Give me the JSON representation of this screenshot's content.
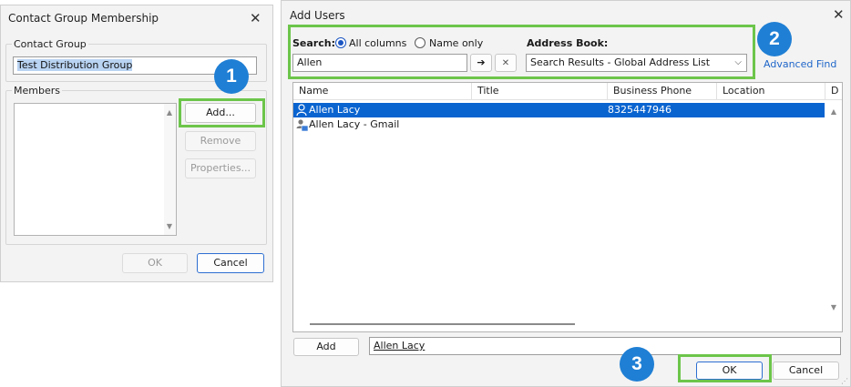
{
  "contact_dialog": {
    "title": "Contact Group Membership",
    "close_glyph": "✕",
    "group_label": "Contact Group",
    "group_name": "Test Distribution Group",
    "members_label": "Members",
    "add_label": "Add...",
    "remove_label": "Remove",
    "properties_label": "Properties...",
    "ok_label": "OK",
    "cancel_label": "Cancel"
  },
  "add_users_dialog": {
    "title": "Add Users",
    "close_glyph": "✕",
    "search_label": "Search:",
    "radio_all_label": "All columns",
    "radio_name_label": "Name only",
    "search_mode": "All columns",
    "search_value": "Allen",
    "go_glyph": "➔",
    "clear_glyph": "✕",
    "address_book_label": "Address Book:",
    "address_book_value": "Search Results - Global Address List",
    "advanced_find_label": "Advanced Find",
    "columns": [
      "Name",
      "Title",
      "Business Phone",
      "Location",
      "D"
    ],
    "results": [
      {
        "name": "Allen Lacy",
        "title": "",
        "phone": "8325447946",
        "location": "",
        "icon": "user-icon",
        "selected": true
      },
      {
        "name": "Allen Lacy - Gmail",
        "title": "",
        "phone": "",
        "location": "",
        "icon": "contact-card-icon",
        "selected": false
      }
    ],
    "add_label": "Add",
    "added_value": "Allen Lacy",
    "ok_label": "OK",
    "cancel_label": "Cancel"
  },
  "steps": [
    "1",
    "2",
    "3"
  ],
  "colors": {
    "highlight": "#6cc54a",
    "badge": "#1f7fd4",
    "selection": "#0a64d0"
  }
}
